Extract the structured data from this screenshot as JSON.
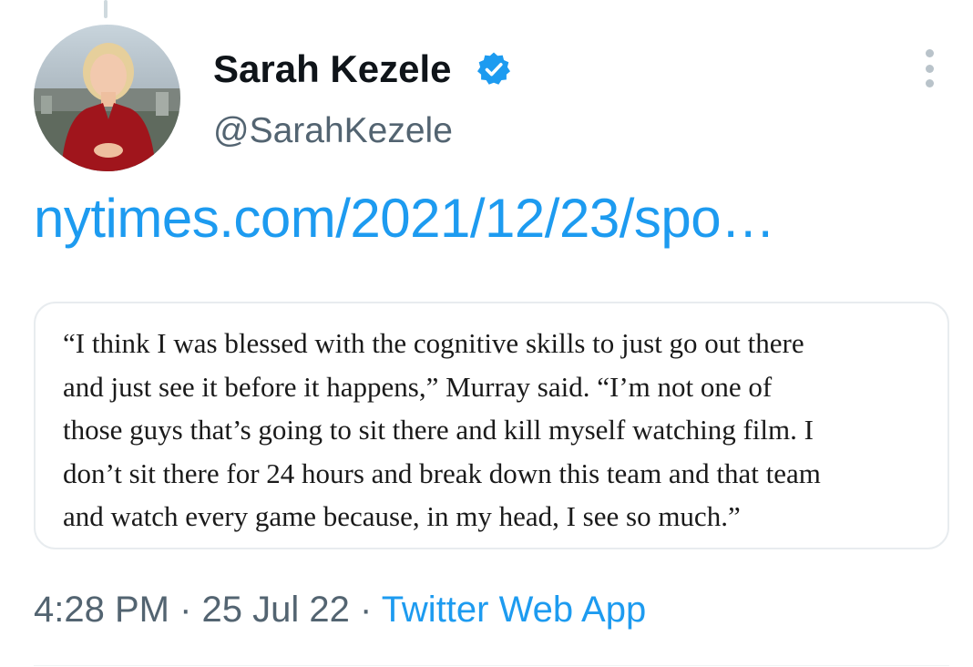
{
  "author": {
    "display_name": "Sarah Kezele",
    "handle": "@SarahKezele",
    "verified": true
  },
  "tweet": {
    "link_text": "nytimes.com/2021/12/23/spo…"
  },
  "quote_card": {
    "lines": [
      "“I think I was blessed with the cognitive skills to just go out there",
      "and just see it before it happens,” Murray said. “I’m not one of",
      "those guys that’s going to sit there and kill myself watching film. I",
      "don’t sit there for 24 hours and break down this team and that team",
      "and watch every game because, in my head, I see so much.”"
    ]
  },
  "meta": {
    "time": "4:28 PM",
    "separator": " · ",
    "date": "25 Jul 22",
    "source": "Twitter Web App"
  },
  "icons": {
    "verified": "verified-badge-icon",
    "more": "more-vertical-icon"
  },
  "colors": {
    "link": "#1d9bf0",
    "text_primary": "#0f1419",
    "text_secondary": "#536471",
    "border": "#e8ecef",
    "avatar_dress": "#a0151c"
  }
}
